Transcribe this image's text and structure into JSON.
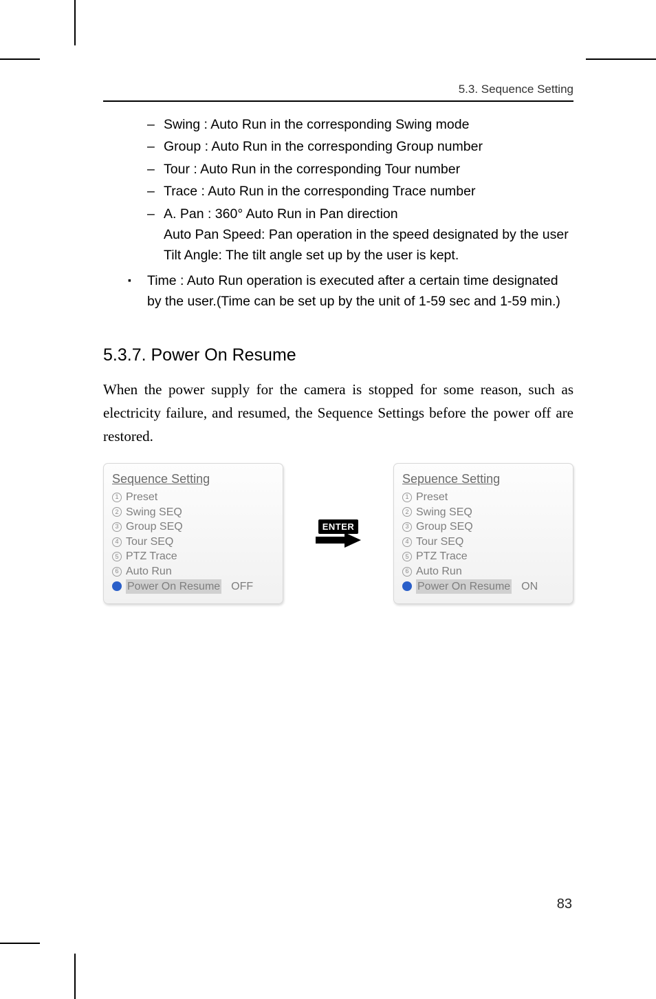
{
  "header": {
    "section_label": "5.3. Sequence Setting"
  },
  "dash_items": {
    "swing": "Swing : Auto Run in the corresponding Swing mode",
    "group": "Group : Auto Run in the corresponding Group number",
    "tour": "Tour : Auto Run in the corresponding Tour number",
    "trace": "Trace : Auto Run in the corresponding Trace number",
    "apan_line1": "A. Pan : 360° Auto Run in Pan direction",
    "apan_line2": "Auto Pan Speed: Pan operation in the speed designated by the user",
    "apan_line3": "Tilt Angle: The tilt angle set up by the user is kept."
  },
  "square_items": {
    "time": "Time : Auto Run operation is executed after a certain time designated by the user.(Time can be set up by the unit of 1-59 sec and 1-59 min.)"
  },
  "heading": "5.3.7. Power On Resume",
  "body": "When the power supply for the camera is stopped for some reason, such as electricity failure, and resumed, the Sequence Settings before the power off are restored.",
  "enter_label": "ENTER",
  "panel_left": {
    "title": "Sequence Setting",
    "items": [
      {
        "num": "1",
        "label": "Preset"
      },
      {
        "num": "2",
        "label": "Swing SEQ"
      },
      {
        "num": "3",
        "label": "Group SEQ"
      },
      {
        "num": "4",
        "label": "Tour SEQ"
      },
      {
        "num": "5",
        "label": "PTZ Trace"
      },
      {
        "num": "6",
        "label": "Auto Run"
      }
    ],
    "power_label": "Power On Resume",
    "power_value": "OFF"
  },
  "panel_right": {
    "title": "Sepuence Setting",
    "items": [
      {
        "num": "1",
        "label": "Preset"
      },
      {
        "num": "2",
        "label": "Swing SEQ"
      },
      {
        "num": "3",
        "label": "Group SEQ"
      },
      {
        "num": "4",
        "label": "Tour SEQ"
      },
      {
        "num": "5",
        "label": "PTZ Trace"
      },
      {
        "num": "6",
        "label": "Auto Run"
      }
    ],
    "power_label": "Power On Resume",
    "power_value": "ON"
  },
  "page_number": "83"
}
